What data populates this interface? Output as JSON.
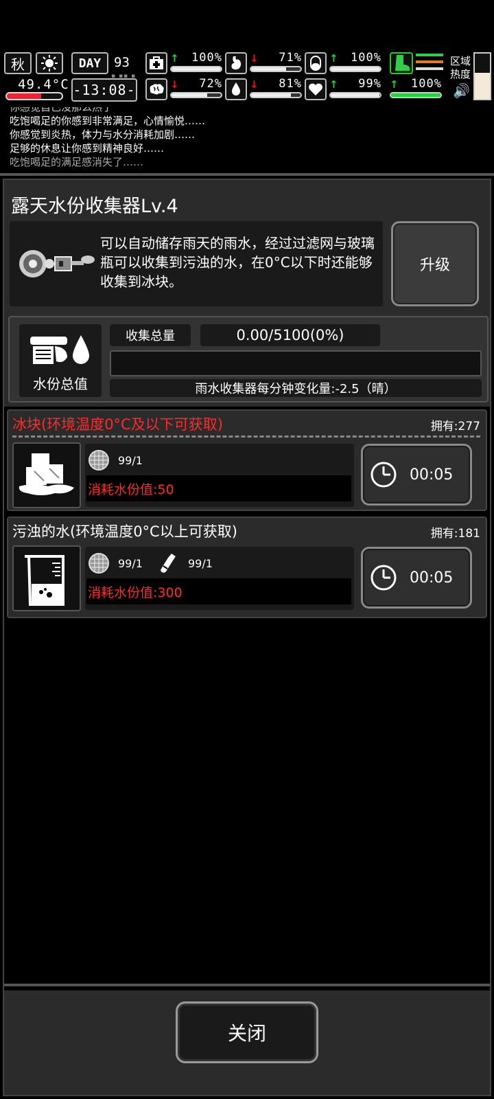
{
  "hud": {
    "season": "秋",
    "temperature": "49.4°C",
    "day_label": "DAY",
    "day_number": "93",
    "clock": "-13:08-",
    "stats": [
      {
        "name": "health",
        "trend": "up",
        "value": "100%",
        "level": 1.0
      },
      {
        "name": "hunger",
        "trend": "down",
        "value": "71%",
        "level": 0.71
      },
      {
        "name": "energy",
        "trend": "up",
        "value": "100%",
        "level": 1.0
      },
      {
        "name": "mood",
        "trend": "down",
        "value": "72%",
        "level": 0.72
      },
      {
        "name": "thirst",
        "trend": "down",
        "value": "81%",
        "level": 0.81
      },
      {
        "name": "spirit",
        "trend": "up",
        "value": "99%",
        "level": 0.99
      },
      {
        "name": "stamina",
        "trend": "up",
        "value": "100%",
        "level": 1.0
      }
    ],
    "area_heat_label": "区域热度",
    "area_heat_level": 0.58
  },
  "log": {
    "lines": [
      "你感觉自己没那么热了",
      "吃饱喝足的你感到非常满足，心情愉悦……",
      "你感觉到炎热，体力与水分消耗加剧……",
      "足够的休息让你感到精神良好……",
      "吃饱喝足的满足感消失了……"
    ]
  },
  "panel": {
    "title": "露天水份收集器Lv.4",
    "description": "可以自动储存雨天的雨水，经过过滤网与玻璃瓶可以收集到污浊的水，在0°C以下时还能够收集到冰块。",
    "upgrade_label": "升级",
    "water_total_label": "水份总值",
    "collect_label": "收集总量",
    "collect_value": "0.00/5100(0%)",
    "collect_progress": 0,
    "change_rate": "雨水收集器每分钟变化量:-2.5（晴）",
    "close_label": "关闭"
  },
  "items": [
    {
      "title": "冰块(环境温度0°C及以下可获取)",
      "title_color": "#ff2a2a",
      "own": "拥有:277",
      "requirements": [
        {
          "icon": "filter-mesh-icon",
          "count": "99/1"
        }
      ],
      "cost": "消耗水份值:50",
      "time": "00:05"
    },
    {
      "title": "污浊的水(环境温度0°C以上可获取)",
      "title_color": "#ffffff",
      "own": "拥有:181",
      "requirements": [
        {
          "icon": "filter-mesh-icon",
          "count": "99/1"
        },
        {
          "icon": "glass-bottle-icon",
          "count": "99/1"
        }
      ],
      "cost": "消耗水份值:300",
      "time": "00:05"
    }
  ]
}
